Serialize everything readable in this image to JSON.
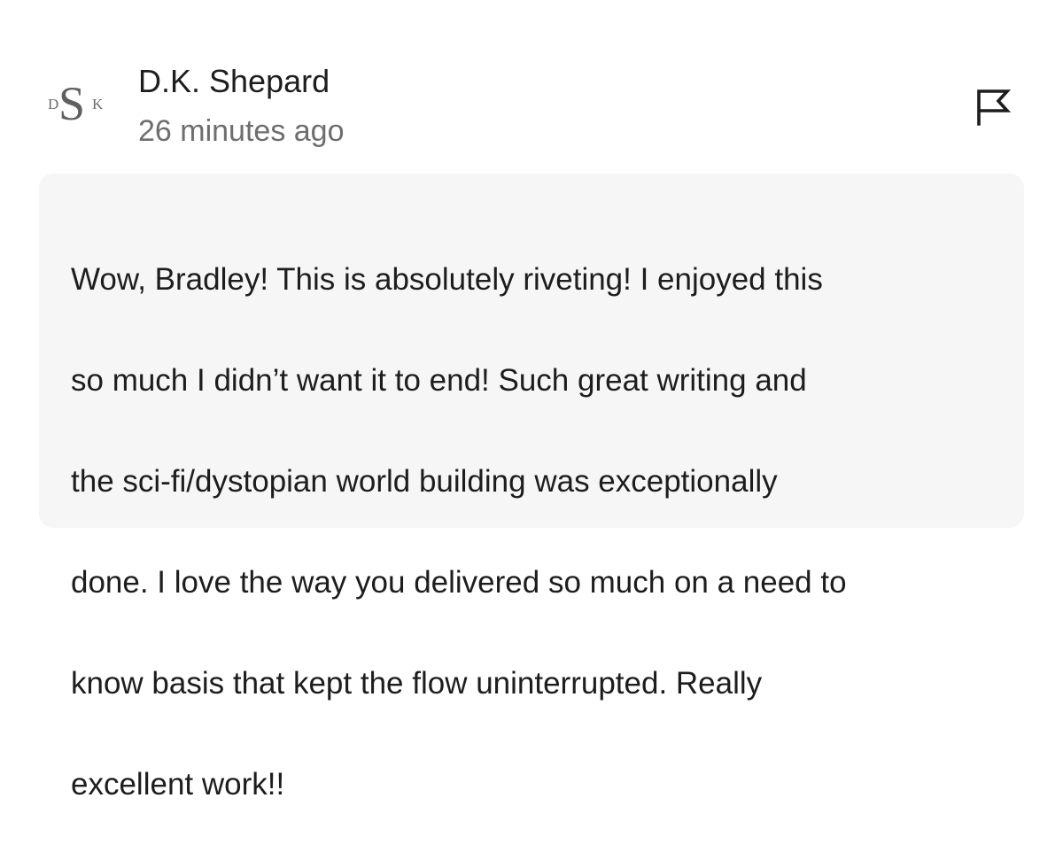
{
  "comment": {
    "avatar": {
      "monogram_left": "D",
      "monogram_center": "S",
      "monogram_right": "K"
    },
    "author": "D.K. Shepard",
    "timestamp": "26 minutes ago",
    "flag_icon": "flag-icon",
    "lines": [
      "Wow, Bradley! This is absolutely riveting! I enjoyed this",
      "so much I didn’t want it to end! Such great writing and",
      "the sci-fi/dystopian world building was exceptionally",
      "done. I love the way you delivered so much on a need to",
      "know basis that kept the flow uninterrupted. Really",
      "excellent work!!"
    ]
  }
}
